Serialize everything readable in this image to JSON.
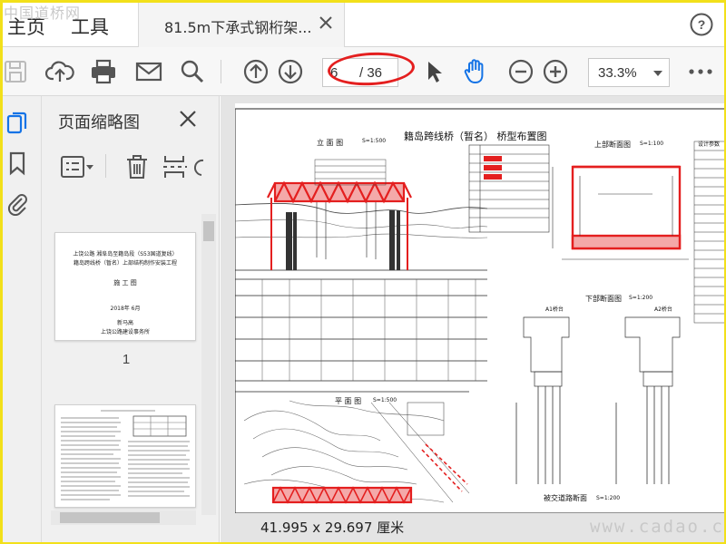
{
  "watermark_top": "中国道桥网",
  "watermark_bottom": "www.cadao.com",
  "menu": {
    "home": "主页",
    "tools": "工具"
  },
  "tab": {
    "title": "81.5m下承式钢桁架..."
  },
  "toolbar": {
    "page_current": "6",
    "page_total": "/ 36",
    "zoom": "33.3%"
  },
  "thumbnails": {
    "title": "页面缩略图",
    "page1": {
      "line1": "上饶公路 湘阜岛至籍岛段（S53国道复线）",
      "line2": "籍岛跨线桥（暂名）上部结构制作安装工程",
      "heading": "施 工 图",
      "date": "2018年  6月",
      "org1": "新马高",
      "org2": "上饶公路建设事务所",
      "number": "1"
    }
  },
  "document": {
    "title": "籍岛跨线桥（暂名） 桥型布置图",
    "elevation": "立  面  图",
    "elevation_scale": "S=1:500",
    "upper_section": "上部断面图",
    "upper_scale": "S=1:100",
    "lower_section": "下部断面图",
    "lower_scale": "S=1:200",
    "plan": "平  面  图",
    "plan_scale": "S=1:500",
    "pier_a1": "A1桥台",
    "pier_a2": "A2桥台",
    "intersection": "被交道路断面",
    "intersection_scale": "S=1:200",
    "design_params": "设计参数"
  },
  "status": {
    "page_size": "41.995 x 29.697 厘米"
  },
  "colors": {
    "accent_red": "#e41f1f",
    "frame_yellow": "#f2e01a",
    "hand_tool_blue": "#1473e6"
  }
}
